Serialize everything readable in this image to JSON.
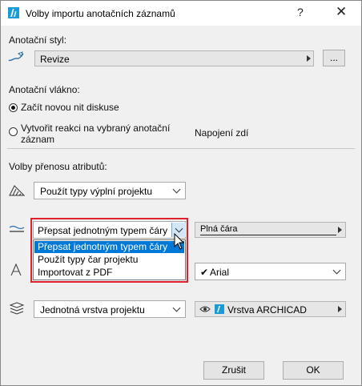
{
  "window": {
    "title": "Volby importu anotačních záznamů",
    "help": "?",
    "close": "✕"
  },
  "annotation_style": {
    "label": "Anotační styl:",
    "value": "Revize",
    "more_button": "..."
  },
  "annotation_thread": {
    "label": "Anotační vlákno:",
    "option_new": "Začít novou nit diskuse",
    "option_reply_line1": "Vytvořit reakci na vybraný anotační",
    "option_reply_line2": "záznam",
    "selected": "new",
    "wall_connection": "Napojení zdí"
  },
  "attributes": {
    "label": "Volby přenosu atributů:",
    "fill_select": "Použít typy výplní projektu",
    "line_select": "Přepsat jednotným typem čáry",
    "line_type_value": "Plná čára",
    "font_value": "Arial",
    "font_check": "✔",
    "layer_select": "Jednotná vrstva projektu",
    "layer_value": "Vrstva ARCHICAD"
  },
  "dropdown": {
    "options": [
      "Přepsat jednotným typem čáry",
      "Použít typy čar projektu",
      "Importovat z PDF"
    ],
    "selected_index": 0
  },
  "footer": {
    "cancel": "Zrušit",
    "ok": "OK"
  },
  "colors": {
    "highlight": "#e0202a",
    "selection": "#0078d7"
  }
}
